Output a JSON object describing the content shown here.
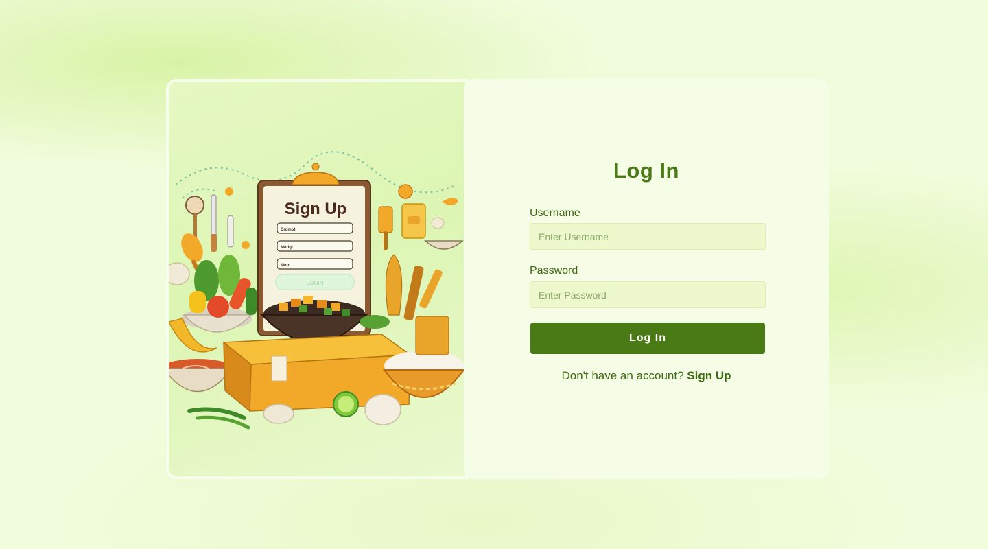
{
  "illustration": {
    "clipboard_title": "Sign Up",
    "clipboard_fields": [
      "Cromot",
      "Merigi",
      "Mero"
    ],
    "clipboard_button": "LOGIN"
  },
  "form": {
    "title": "Log In",
    "username_label": "Username",
    "username_placeholder": "Enter Username",
    "username_value": "",
    "password_label": "Password",
    "password_placeholder": "Enter Password",
    "password_value": "",
    "submit_label": "Log In",
    "signup_prompt": "Don't have an account?",
    "signup_link": "Sign Up"
  },
  "colors": {
    "accent": "#4a7a15",
    "panel": "#f5fde6",
    "input_bg": "#edf9cd",
    "page_bg": "#f1fcdc"
  }
}
